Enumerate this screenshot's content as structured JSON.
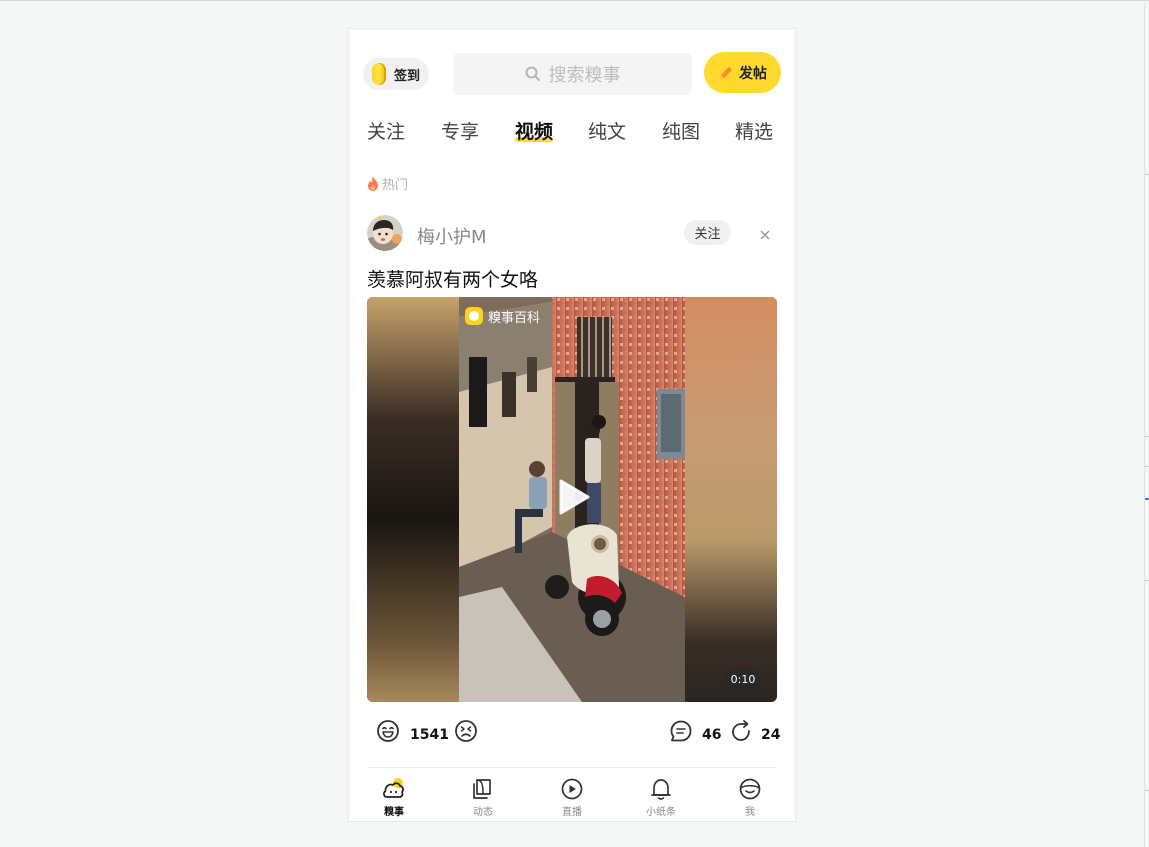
{
  "header": {
    "checkin_label": "签到",
    "search_placeholder": "搜索糗事",
    "post_label": "发帖"
  },
  "tabs": [
    {
      "label": "关注",
      "active": false
    },
    {
      "label": "专享",
      "active": false
    },
    {
      "label": "视频",
      "active": true
    },
    {
      "label": "纯文",
      "active": false
    },
    {
      "label": "纯图",
      "active": false
    },
    {
      "label": "精选",
      "active": false
    }
  ],
  "section_label": "热门",
  "post": {
    "author": "梅小护M",
    "follow_label": "关注",
    "title": "羡慕阿叔有两个女咯",
    "video": {
      "watermark": "糗事百科",
      "duration": "0:10"
    },
    "stats": {
      "likes": "1541",
      "comments": "46",
      "shares": "24"
    }
  },
  "bottom_nav": [
    {
      "label": "糗事",
      "icon": "qiushi-icon",
      "active": true
    },
    {
      "label": "动态",
      "icon": "feed-icon",
      "active": false
    },
    {
      "label": "直播",
      "icon": "live-play-icon",
      "active": false
    },
    {
      "label": "小纸条",
      "icon": "bell-icon",
      "active": false
    },
    {
      "label": "我",
      "icon": "profile-icon",
      "active": false
    }
  ],
  "colors": {
    "accent": "#ffd92e",
    "hot": "#ff7a45"
  }
}
